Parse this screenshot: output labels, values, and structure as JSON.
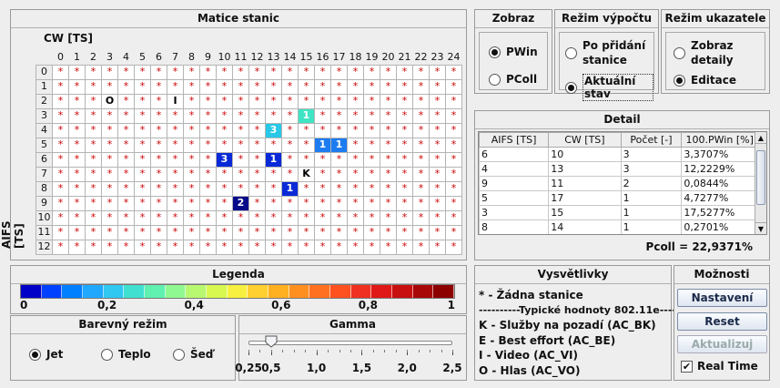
{
  "matrix": {
    "title": "Matice stanic",
    "cw_label": "CW [TS]",
    "aifs_label": "AIFS [TS]",
    "columns": [
      "0",
      "1",
      "2",
      "3",
      "4",
      "5",
      "6",
      "7",
      "8",
      "9",
      "10",
      "11",
      "12",
      "13",
      "14",
      "15",
      "16",
      "17",
      "18",
      "19",
      "20",
      "21",
      "22",
      "23",
      "24"
    ],
    "rows": [
      "0",
      "1",
      "2",
      "3",
      "4",
      "5",
      "6",
      "7",
      "8",
      "9",
      "10",
      "11",
      "12"
    ],
    "empty_mark": "*",
    "cells": [
      {
        "aifs": 2,
        "cw": 3,
        "text": "O",
        "kind": "letter"
      },
      {
        "aifs": 2,
        "cw": 7,
        "text": "I",
        "kind": "letter"
      },
      {
        "aifs": 3,
        "cw": 15,
        "text": "1",
        "kind": "count",
        "color": "#3fe4c4"
      },
      {
        "aifs": 4,
        "cw": 13,
        "text": "3",
        "kind": "count",
        "color": "#28c8e8"
      },
      {
        "aifs": 5,
        "cw": 16,
        "text": "1",
        "kind": "count",
        "color": "#1c7cf0"
      },
      {
        "aifs": 5,
        "cw": 17,
        "text": "1",
        "kind": "count",
        "color": "#1c7cf0"
      },
      {
        "aifs": 6,
        "cw": 10,
        "text": "3",
        "kind": "count",
        "color": "#0a2ad8"
      },
      {
        "aifs": 6,
        "cw": 13,
        "text": "1",
        "kind": "count",
        "color": "#0a2ad8"
      },
      {
        "aifs": 7,
        "cw": 15,
        "text": "K",
        "kind": "letter"
      },
      {
        "aifs": 8,
        "cw": 14,
        "text": "1",
        "kind": "count",
        "color": "#0a2ad8"
      },
      {
        "aifs": 9,
        "cw": 11,
        "text": "2",
        "kind": "count",
        "color": "#050a8a"
      }
    ]
  },
  "zobraz": {
    "title": "Zobraz",
    "options": [
      "PWin",
      "PColl"
    ],
    "selected": 0
  },
  "rezim_vypoctu": {
    "title": "Režim výpočtu",
    "options": [
      "Po přidání stanice",
      "Aktuální stav"
    ],
    "selected": 1
  },
  "rezim_ukazatele": {
    "title": "Režim ukazatele",
    "options": [
      "Zobraz detaily",
      "Editace"
    ],
    "selected": 1
  },
  "detail": {
    "title": "Detail",
    "headers": [
      "AIFS [TS]",
      "CW [TS]",
      "Počet [-]",
      "100.PWin [%]"
    ],
    "rows": [
      [
        "6",
        "10",
        "3",
        "3,3707%"
      ],
      [
        "4",
        "13",
        "3",
        "12,2229%"
      ],
      [
        "9",
        "11",
        "2",
        "0,0844%"
      ],
      [
        "5",
        "17",
        "1",
        "4,7277%"
      ],
      [
        "3",
        "15",
        "1",
        "17,5277%"
      ],
      [
        "8",
        "14",
        "1",
        "0,2701%"
      ]
    ],
    "pcoll": "Pcoll = 22,9371%"
  },
  "legenda": {
    "title": "Legenda",
    "colors": [
      "#0000c8",
      "#0040ff",
      "#0080ff",
      "#20a8ff",
      "#30c8f0",
      "#40e0d0",
      "#60f0b0",
      "#90f890",
      "#b8f870",
      "#d8f850",
      "#f8f040",
      "#ffd030",
      "#ffb020",
      "#ff9020",
      "#ff7020",
      "#ff5020",
      "#f03020",
      "#e01818",
      "#c81010",
      "#a80808",
      "#8c0000"
    ],
    "ticks": [
      "0",
      "0,2",
      "0,4",
      "0,6",
      "0,8",
      "1"
    ]
  },
  "barevny_rezim": {
    "title": "Barevný režim",
    "options": [
      "Jet",
      "Teplo",
      "Šeď"
    ],
    "selected": 0
  },
  "gamma": {
    "title": "Gamma",
    "ticks": [
      "0,25",
      "0,5",
      "1,0",
      "1,5",
      "2,0",
      "2,5"
    ],
    "value": 0.5
  },
  "vysvetlivky": {
    "title": "Vysvětlivky",
    "lines": [
      "* - Žádna stanice",
      "----------Typické hodnoty 802.11e----------",
      "K - Služby na pozadí (AC_BK)",
      "E - Best effort (AC_BE)",
      "I - Video (AC_VI)",
      "O - Hlas (AC_VO)"
    ]
  },
  "moznosti": {
    "title": "Možnosti",
    "nastaveni": "Nastavení",
    "reset": "Reset",
    "aktualizuj": "Aktualizuj",
    "realtime": "Real Time",
    "realtime_checked": true
  }
}
